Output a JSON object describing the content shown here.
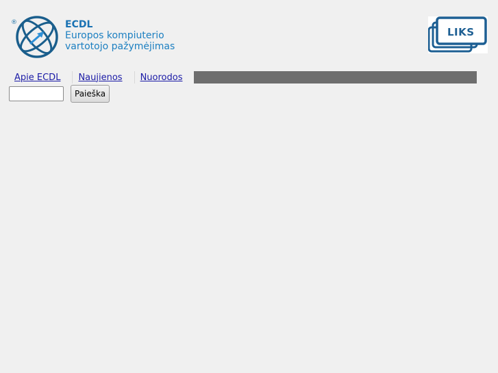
{
  "header": {
    "ecdl_logo": {
      "icon": "ecdl-globe-arrow-icon",
      "registered_mark": "®",
      "brand": "ECDL",
      "tagline_line1": "Europos kompiuterio",
      "tagline_line2": "vartotojo pažymėjimas",
      "color": "#1c7fc1"
    },
    "liks_logo": {
      "icon": "liks-stacked-frames-icon",
      "text": "LIKS",
      "color": "#1d5f93"
    }
  },
  "nav": {
    "items": [
      {
        "label": "Apie ECDL"
      },
      {
        "label": "Naujienos"
      },
      {
        "label": "Nuorodos"
      }
    ],
    "bar_color": "#6e6e6e",
    "link_color": "#1a1aa6"
  },
  "search": {
    "value": "",
    "placeholder": "",
    "button_label": "Paieška"
  }
}
